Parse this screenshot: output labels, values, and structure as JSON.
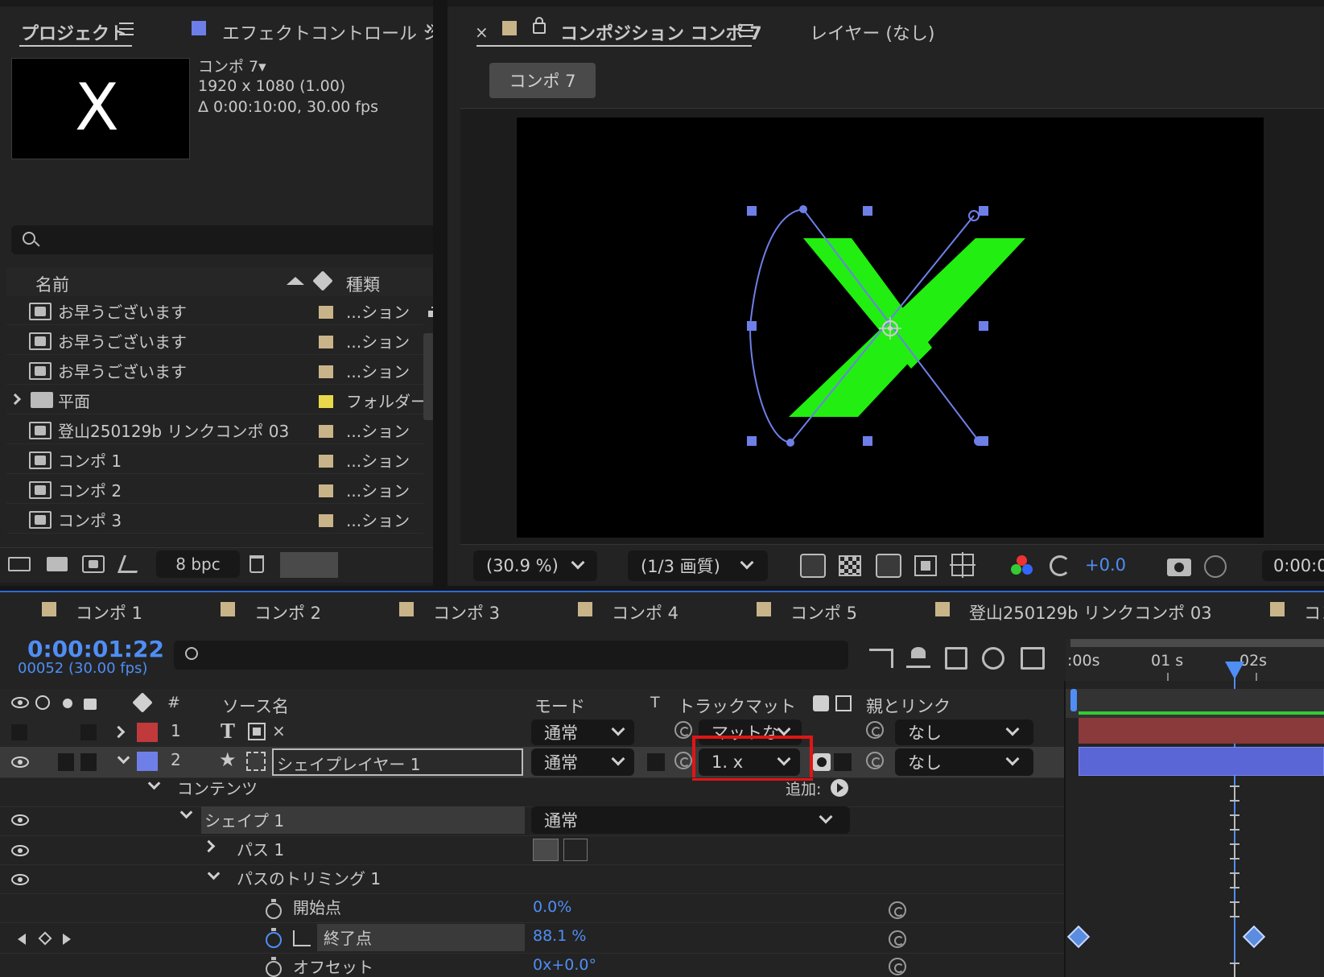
{
  "project_panel": {
    "tab_title": "プロジェクト",
    "effects_tab": "エフェクトコントロール シェイ",
    "more": "»",
    "comp_name": "コンポ 7▾",
    "comp_size": "1920 x 1080 (1.00)",
    "comp_duration": "Δ 0:00:10:00, 30.00 fps",
    "thumb_letter": "X",
    "col_name": "名前",
    "col_type": "種類",
    "items": [
      {
        "name": "お早うございます",
        "type": "...ション",
        "color": "#c9b48a",
        "kind": "comp"
      },
      {
        "name": "お早うございます",
        "type": "...ション",
        "color": "#c9b48a",
        "kind": "comp"
      },
      {
        "name": "お早うございます",
        "type": "...ション",
        "color": "#c9b48a",
        "kind": "comp"
      },
      {
        "name": "平面",
        "type": "フォルダー",
        "color": "#e8d84a",
        "kind": "folder"
      },
      {
        "name": "登山250129b リンクコンポ 03",
        "type": "...ション",
        "color": "#c9b48a",
        "kind": "comp"
      },
      {
        "name": "コンポ 1",
        "type": "...ション",
        "color": "#c9b48a",
        "kind": "comp"
      },
      {
        "name": "コンポ 2",
        "type": "...ション",
        "color": "#c9b48a",
        "kind": "comp"
      },
      {
        "name": "コンポ 3",
        "type": "...ション",
        "color": "#c9b48a",
        "kind": "comp"
      }
    ],
    "bpc": "8 bpc"
  },
  "comp_panel": {
    "close": "×",
    "tab_title": "コンポジション コンポ 7",
    "layer_tab": "レイヤー (なし)",
    "breadcrumb": "コンポ 7",
    "zoom": "(30.9 %)",
    "quality": "(1/3 画質)",
    "exposure": "+0.0",
    "timecode": "0:00:0",
    "x_color": "#22ee11"
  },
  "timeline": {
    "tabs": [
      "コンポ 1",
      "コンポ 2",
      "コンポ 3",
      "コンポ 4",
      "コンポ 5",
      "登山250129b リンクコンポ 03",
      "コン"
    ],
    "timecode": "0:00:01:22",
    "frames": "00052 (30.00 fps)",
    "ruler": [
      ":00s",
      "01 s",
      "02s"
    ],
    "headers": {
      "hash": "#",
      "source": "ソース名",
      "mode": "モード",
      "t": "T",
      "trackmatte": "トラックマット",
      "parent": "親とリンク"
    },
    "layers": [
      {
        "num": "1",
        "name": "×",
        "mode": "通常",
        "matte": "マットな",
        "parent": "なし",
        "color": "#c0393b"
      },
      {
        "num": "2",
        "name": "シェイプレイヤー 1",
        "mode": "通常",
        "matte": "1. x",
        "parent": "なし",
        "color": "#6f7fe8"
      }
    ],
    "contents": "コンテンツ",
    "add": "追加:",
    "shape": "シェイプ 1",
    "shape_mode": "通常",
    "path": "パス 1",
    "trim": "パスのトリミング 1",
    "start_label": "開始点",
    "start_value": "0.0%",
    "end_label": "終了点",
    "end_value": "88.1 %",
    "offset_label": "オフセット",
    "offset_value": "0x+0.0°"
  }
}
